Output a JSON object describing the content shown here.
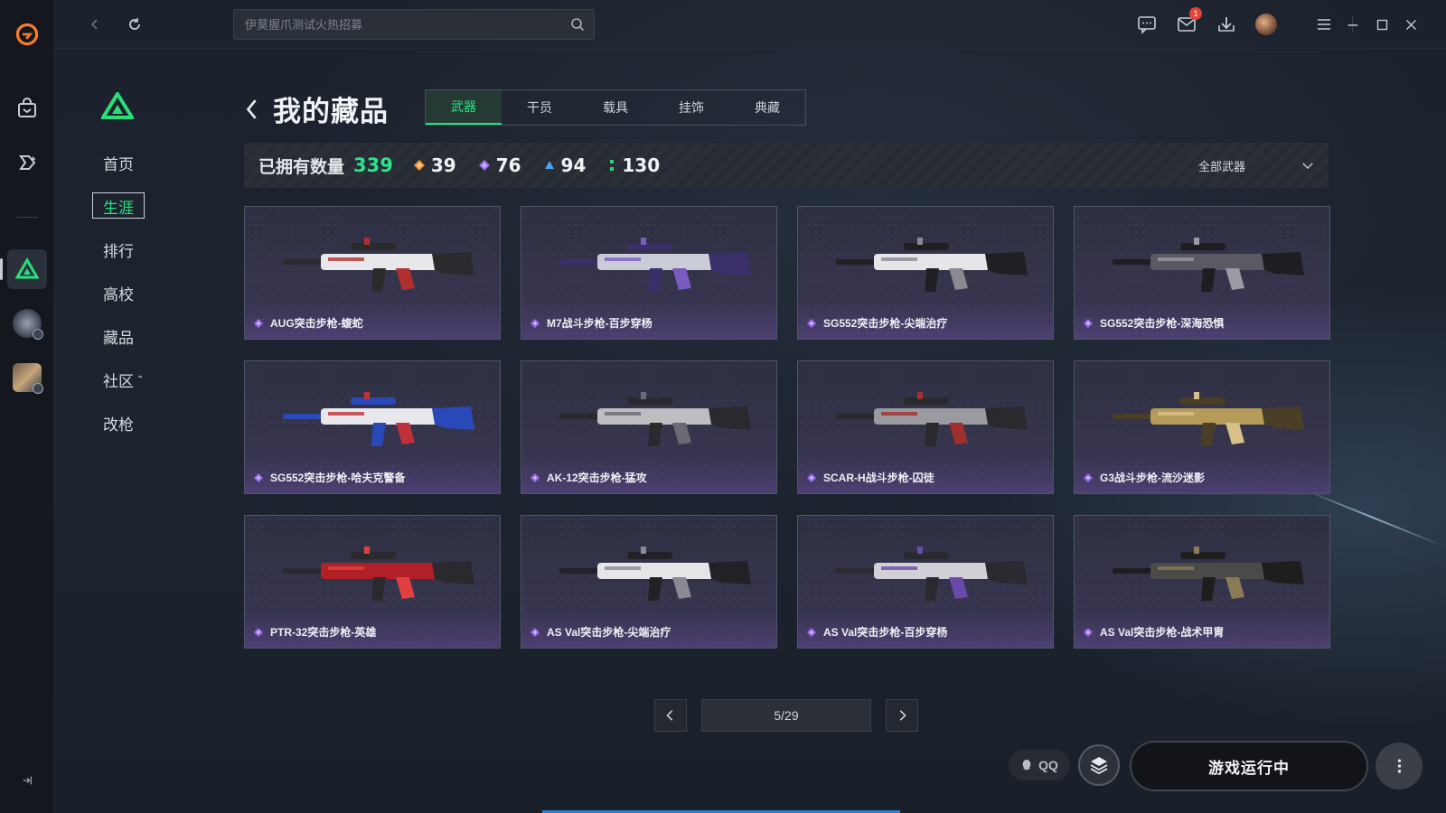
{
  "app": {
    "accent": "#27e07b"
  },
  "search": {
    "placeholder": "伊莫握爪测试火热招募"
  },
  "topbar": {
    "mail_badge": "1"
  },
  "sidenav": [
    {
      "label": "首页",
      "active": false
    },
    {
      "label": "生涯",
      "active": true
    },
    {
      "label": "排行",
      "active": false
    },
    {
      "label": "高校",
      "active": false
    },
    {
      "label": "藏品",
      "active": false
    },
    {
      "label": "社区",
      "active": false,
      "caret": "⌃"
    },
    {
      "label": "改枪",
      "active": false
    }
  ],
  "page": {
    "title": "我的藏品"
  },
  "tabs": [
    {
      "label": "武器",
      "active": true
    },
    {
      "label": "干员",
      "active": false
    },
    {
      "label": "载具",
      "active": false
    },
    {
      "label": "挂饰",
      "active": false
    },
    {
      "label": "典藏",
      "active": false
    }
  ],
  "stats": {
    "owned_label": "已拥有数量",
    "owned_total": "339",
    "tiers": [
      {
        "icon": "orange-diamond-icon",
        "color": "#f0913a",
        "count": "39"
      },
      {
        "icon": "purple-diamond-icon",
        "color": "#9c6cf0",
        "count": "76"
      },
      {
        "icon": "blue-tier-icon",
        "color": "#4aa3f0",
        "count": "94"
      },
      {
        "icon": "green-tier-icon",
        "color": "#35d07a",
        "count": "130"
      }
    ],
    "filter_label": "全部武器"
  },
  "items": [
    {
      "name": "AUG突击步枪-蝮蛇",
      "palette": [
        "#e8e8ea",
        "#2b2b2e",
        "#b03030"
      ]
    },
    {
      "name": "M7战斗步枪-百步穿杨",
      "palette": [
        "#c9ccd6",
        "#3a2f6a",
        "#7a5cc0"
      ]
    },
    {
      "name": "SG552突击步枪-尖端治疗",
      "palette": [
        "#e6e6e8",
        "#202022",
        "#8a8a90"
      ]
    },
    {
      "name": "SG552突击步枪-深海恐惧",
      "palette": [
        "#5a5a62",
        "#1e1e22",
        "#9a9aa2"
      ]
    },
    {
      "name": "SG552突击步枪-哈夫克警备",
      "palette": [
        "#e8e8ec",
        "#2a49b8",
        "#c0303a"
      ]
    },
    {
      "name": "AK-12突击步枪-猛攻",
      "palette": [
        "#bdbdc2",
        "#2a2a2e",
        "#6a6a72"
      ]
    },
    {
      "name": "SCAR-H战斗步枪-囚徒",
      "palette": [
        "#9a9aa0",
        "#2a2a2e",
        "#a03030"
      ]
    },
    {
      "name": "G3战斗步枪-流沙迷影",
      "palette": [
        "#b59a5a",
        "#4a3e26",
        "#d8c08a"
      ]
    },
    {
      "name": "PTR-32突击步枪-英雄",
      "palette": [
        "#b02026",
        "#2a2a2e",
        "#e04040"
      ]
    },
    {
      "name": "AS Val突击步枪-尖端治疗",
      "palette": [
        "#e6e6e8",
        "#222226",
        "#8a8a92"
      ]
    },
    {
      "name": "AS Val突击步枪-百步穿杨",
      "palette": [
        "#d0d0d6",
        "#2a2a30",
        "#6a4aa8"
      ]
    },
    {
      "name": "AS Val突击步枪-战术甲胄",
      "palette": [
        "#4a4a48",
        "#1e1e1e",
        "#8a7a58"
      ]
    }
  ],
  "pager": {
    "current": 5,
    "total": 29,
    "label": "5/29"
  },
  "bottom": {
    "qq_label": "QQ",
    "launch_label": "游戏运行中"
  }
}
